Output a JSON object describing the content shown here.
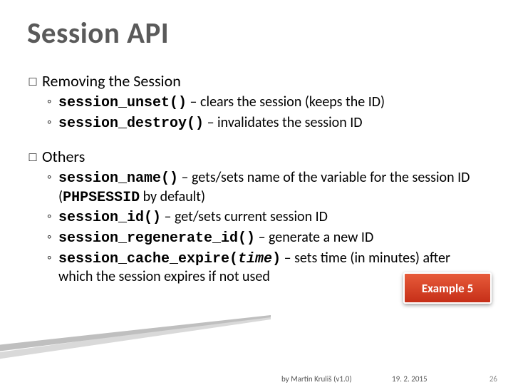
{
  "title": "Session API",
  "section1": {
    "heading": "Removing the Session",
    "items": [
      {
        "code": "session_unset()",
        "text": " – clears the session (keeps the ID)"
      },
      {
        "code": "session_destroy()",
        "text": " – invalidates the session ID"
      }
    ]
  },
  "section2": {
    "heading": "Others",
    "items": [
      {
        "code": "session_name()",
        "text": " – gets/sets name of the variable for the session ID (",
        "code2": "PHPSESSID",
        "text2": " by default)"
      },
      {
        "code": "session_id()",
        "text": " – get/sets current session ID"
      },
      {
        "code": "session_regenerate_id()",
        "text": " – generate a new ID"
      },
      {
        "code": "session_cache_expire(",
        "arg": "time",
        "code_close": ")",
        "text": " – sets time (in minutes) after which the session expires if not used"
      }
    ]
  },
  "badge": "Example 5",
  "footer": {
    "author": "by Martin Kruliš (v1.0)",
    "date": "19. 2. 2015",
    "page": "26"
  }
}
